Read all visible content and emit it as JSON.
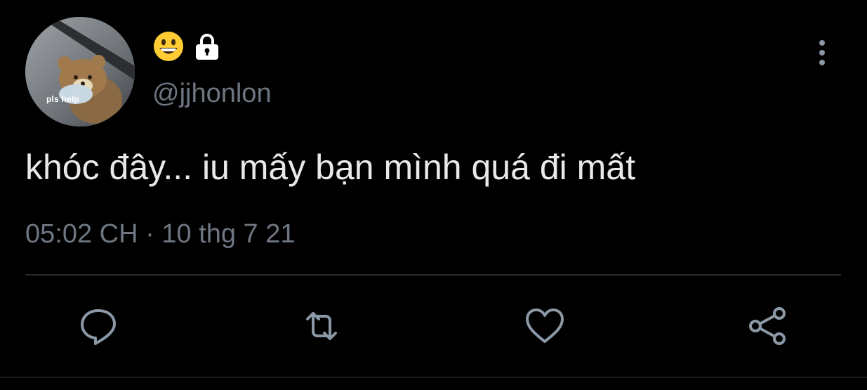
{
  "tweet": {
    "avatar_caption": "pls help",
    "display_name_icons": [
      "grinning-face-emoji",
      "lock-icon"
    ],
    "handle": "@jjhonlon",
    "text": "khóc đây... iu mấy bạn mình quá đi mất",
    "timestamp": "05:02 CH · 10 thg 7 21"
  },
  "actions": [
    {
      "icon": "reply-icon"
    },
    {
      "icon": "retweet-icon"
    },
    {
      "icon": "like-icon"
    },
    {
      "icon": "share-icon"
    }
  ],
  "colors": {
    "background": "#000000",
    "text": "#e7e9ea",
    "secondary": "#6e7681",
    "divider": "#2a2d31",
    "icon": "#8b98a5"
  }
}
